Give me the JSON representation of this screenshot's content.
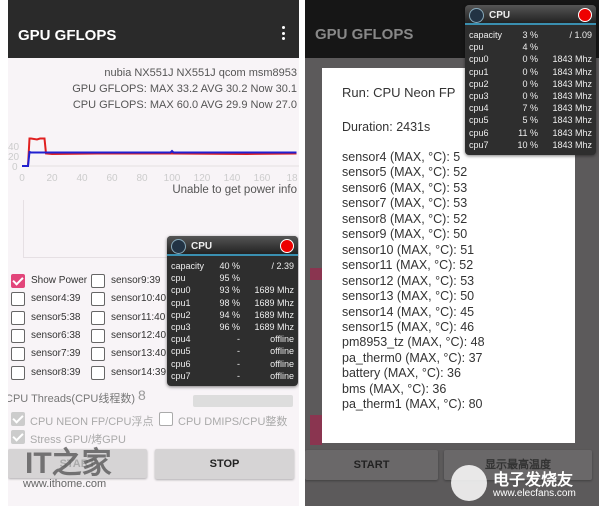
{
  "left": {
    "title": "GPU GFLOPS",
    "device": "nubia NX551J NX551J qcom msm8953",
    "gpu_stats": "GPU GFLOPS: MAX 33.2 AVG 30.2 Now 30.1",
    "cpu_stats": "CPU GFLOPS: MAX 60.0 AVG 29.9 Now 27.0",
    "chart": {
      "type": "line",
      "y_ticks": [
        "0",
        "20",
        "40"
      ],
      "x_ticks": [
        "0",
        "20",
        "40",
        "60",
        "80",
        "100",
        "120",
        "140",
        "160",
        "18"
      ],
      "series": [
        {
          "color": "#e02020",
          "x": [
            0,
            4,
            5,
            6,
            10,
            12,
            15,
            16,
            20,
            50,
            100,
            150,
            183
          ],
          "y": [
            0,
            0,
            55,
            55,
            53,
            55,
            55,
            25,
            24,
            25,
            25,
            24,
            25
          ]
        },
        {
          "color": "#2020d0",
          "x": [
            0,
            4,
            5,
            6,
            15,
            16,
            50,
            99,
            100,
            101,
            150,
            183
          ],
          "y": [
            0,
            0,
            28,
            27,
            27,
            27,
            27,
            27,
            30,
            27,
            27,
            27
          ]
        }
      ]
    },
    "power_info": "Unable to get power info",
    "checkboxes_col1": [
      {
        "label": "Show Power",
        "checked": true
      },
      {
        "label": "sensor4:39"
      },
      {
        "label": "sensor5:38"
      },
      {
        "label": "sensor6:38"
      },
      {
        "label": "sensor7:39"
      },
      {
        "label": "sensor8:39"
      }
    ],
    "checkboxes_col2": [
      {
        "label": "sensor9:39"
      },
      {
        "label": "sensor10:40"
      },
      {
        "label": "sensor11:40"
      },
      {
        "label": "sensor12:40"
      },
      {
        "label": "sensor13:40"
      },
      {
        "label": "sensor14:39"
      }
    ],
    "threads_label": "CPU Threads(CPU线程数)",
    "threads_value": "8",
    "opt_neon": "CPU NEON FP/CPU浮点",
    "opt_dmips": "CPU DMIPS/CPU整数",
    "opt_stress": "Stress GPU/烤GPU",
    "start": "START",
    "stop": "STOP",
    "watermark": "IT之家",
    "watermark_url": "www.ithome.com",
    "cpu_overlay": {
      "title": "CPU",
      "rows": [
        [
          "capacity",
          "40 %",
          "/ 2.39"
        ],
        [
          "cpu",
          "95 %",
          ""
        ],
        [
          "cpu0",
          "93 %",
          "1689 Mhz"
        ],
        [
          "cpu1",
          "98 %",
          "1689 Mhz"
        ],
        [
          "cpu2",
          "94 %",
          "1689 Mhz"
        ],
        [
          "cpu3",
          "96 %",
          "1689 Mhz"
        ],
        [
          "cpu4",
          "-",
          "offline"
        ],
        [
          "cpu5",
          "-",
          "offline"
        ],
        [
          "cpu6",
          "-",
          "offline"
        ],
        [
          "cpu7",
          "-",
          "offline"
        ]
      ]
    }
  },
  "right": {
    "title": "GPU GFLOPS",
    "dialog": {
      "run": "Run: CPU Neon FP",
      "duration": "Duration: 2431s",
      "lines": [
        "sensor4 (MAX, °C):   5",
        "sensor5 (MAX, °C):   52",
        "sensor6 (MAX, °C):   53",
        "sensor7 (MAX, °C):   53",
        "sensor8 (MAX, °C):   52",
        "sensor9 (MAX, °C):   50",
        "sensor10 (MAX, °C):   51",
        "sensor11 (MAX, °C):   52",
        "sensor12 (MAX, °C):   53",
        "sensor13 (MAX, °C):   50",
        "sensor14 (MAX, °C):   45",
        "sensor15 (MAX, °C):   46",
        "pm8953_tz (MAX, °C):   48",
        "pa_therm0 (MAX, °C):   37",
        "battery (MAX, °C):   36",
        "bms (MAX, °C):   36",
        "pa_therm1 (MAX, °C):   80"
      ]
    },
    "start": "START",
    "max_temp": "显示最高温度",
    "watermark": "电子发烧友",
    "watermark_url": "www.elecfans.com",
    "cpu_overlay": {
      "title": "CPU",
      "rows": [
        [
          "capacity",
          "3 %",
          "/ 1.09"
        ],
        [
          "cpu",
          "4 %",
          ""
        ],
        [
          "cpu0",
          "0 %",
          "1843 Mhz"
        ],
        [
          "cpu1",
          "0 %",
          "1843 Mhz"
        ],
        [
          "cpu2",
          "0 %",
          "1843 Mhz"
        ],
        [
          "cpu3",
          "0 %",
          "1843 Mhz"
        ],
        [
          "cpu4",
          "7 %",
          "1843 Mhz"
        ],
        [
          "cpu5",
          "5 %",
          "1843 Mhz"
        ],
        [
          "cpu6",
          "11 %",
          "1843 Mhz"
        ],
        [
          "cpu7",
          "10 %",
          "1843 Mhz"
        ]
      ]
    }
  }
}
